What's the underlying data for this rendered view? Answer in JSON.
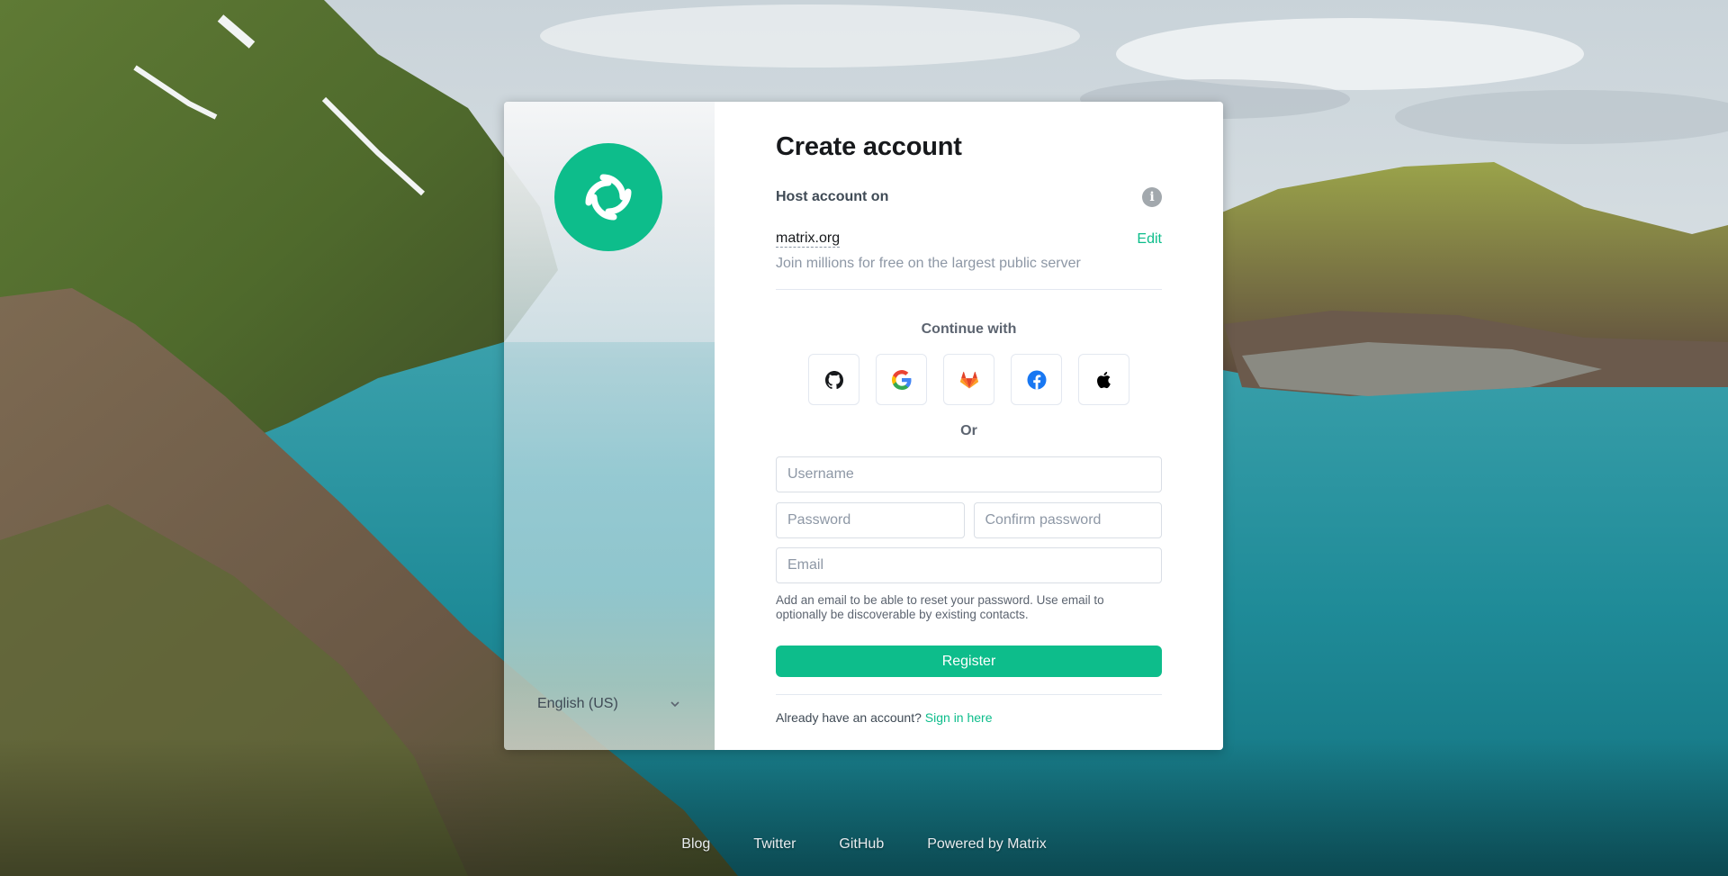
{
  "card": {
    "language_selector": {
      "label": "English (US)"
    },
    "title": "Create account",
    "host": {
      "label": "Host account on",
      "server_name": "matrix.org",
      "edit_label": "Edit",
      "description": "Join millions for free on the largest public server"
    },
    "sso": {
      "label": "Continue with",
      "providers": [
        "github-icon",
        "google-icon",
        "gitlab-icon",
        "facebook-icon",
        "apple-icon"
      ]
    },
    "or_label": "Or",
    "form": {
      "username_placeholder": "Username",
      "password_placeholder": "Password",
      "confirm_password_placeholder": "Confirm password",
      "email_placeholder": "Email",
      "email_help": "Add an email to be able to reset your password. Use email to optionally be discoverable by existing contacts.",
      "register_label": "Register"
    },
    "signin": {
      "prompt": "Already have an account?",
      "link": "Sign in here"
    }
  },
  "footer": {
    "links": [
      "Blog",
      "Twitter",
      "GitHub",
      "Powered by Matrix"
    ]
  },
  "colors": {
    "accent": "#0dbd8b",
    "text_primary": "#17191c",
    "text_secondary": "#8d97a5"
  }
}
